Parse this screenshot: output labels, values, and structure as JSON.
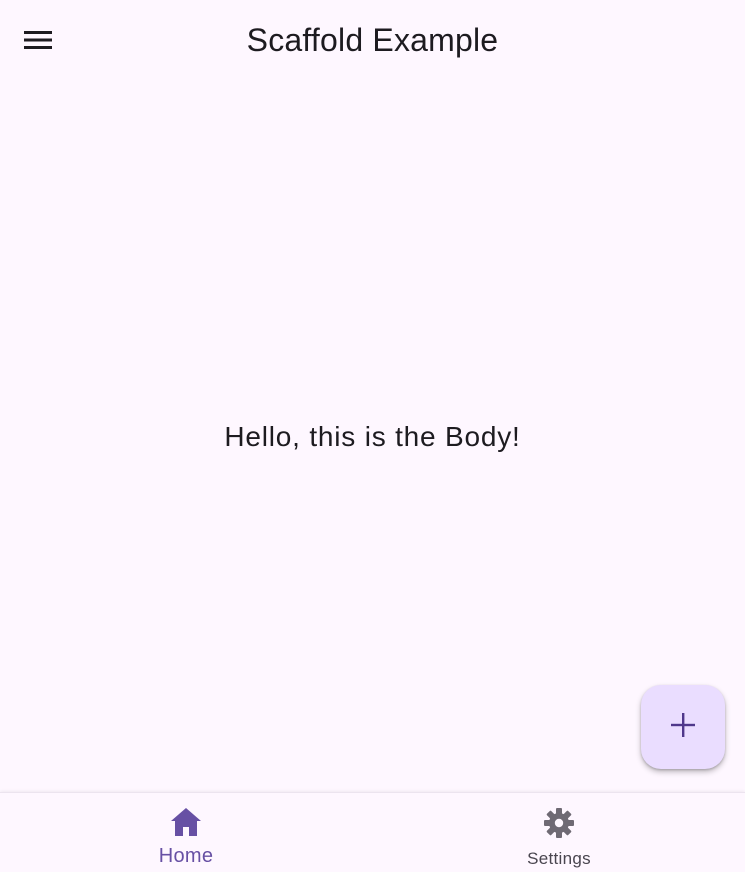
{
  "app_bar": {
    "title": "Scaffold Example",
    "menu_icon": "menu-icon"
  },
  "body": {
    "text": "Hello, this is the Body!"
  },
  "fab": {
    "icon": "add-icon"
  },
  "bottom_nav": {
    "items": [
      {
        "label": "Home",
        "icon": "home-icon",
        "selected": true
      },
      {
        "label": "Settings",
        "icon": "gear-icon",
        "selected": false
      }
    ]
  },
  "colors": {
    "background": "#fef7ff",
    "primary": "#6750a4",
    "fab_container": "#eaddff",
    "fab_icon": "#4f378b",
    "on_surface": "#1d1b20",
    "on_surface_variant": "#49454f",
    "unselected_icon": "#6f6a74"
  }
}
